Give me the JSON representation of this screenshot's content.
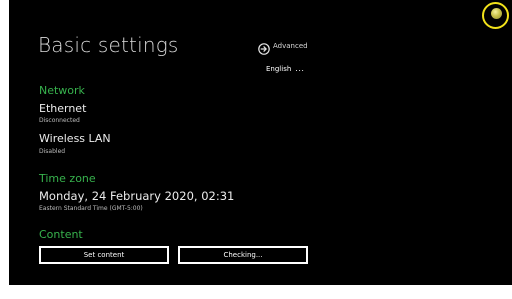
{
  "header": {
    "title": "Basic settings",
    "advanced_label": "Advanced",
    "language_label": "English",
    "language_more": "..."
  },
  "network": {
    "heading": "Network",
    "ethernet": {
      "label": "Ethernet",
      "status": "Disconnected"
    },
    "wireless": {
      "label": "Wireless LAN",
      "status": "Disabled"
    }
  },
  "timezone": {
    "heading": "Time zone",
    "datetime": "Monday, 24 February 2020, 02:31",
    "zone": "Eastern Standard Time (GMT-5:00)"
  },
  "content": {
    "heading": "Content",
    "set_content_label": "Set content",
    "status_button_label": "Checking..."
  },
  "colors": {
    "background": "#000000",
    "section_heading": "#37b24d",
    "text": "#ececec",
    "cursor_ring": "#f2e21a"
  },
  "icons": {
    "advanced": "circle-arrow-right-icon",
    "cursor": "pointer-cursor-icon"
  }
}
